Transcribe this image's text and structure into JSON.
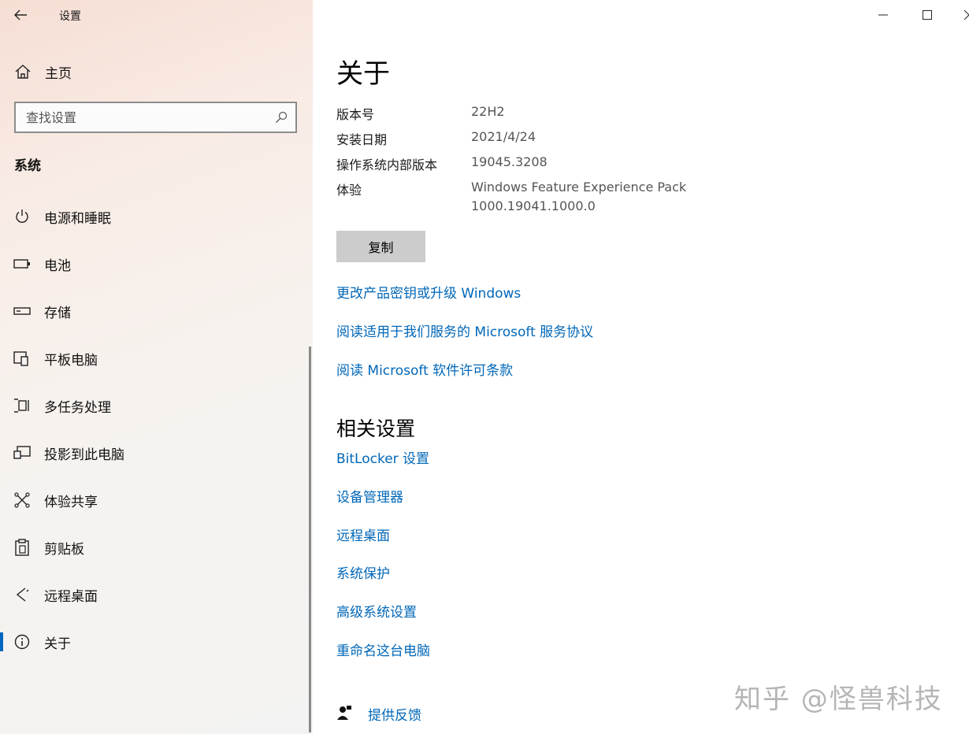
{
  "window": {
    "title": "设置",
    "controls": [
      "minimize-icon",
      "maximize-icon",
      "close-icon"
    ]
  },
  "sidebar": {
    "home_label": "主页",
    "search_placeholder": "查找设置",
    "section_label": "系统",
    "items": [
      {
        "label": "电源和睡眠",
        "icon": "power-icon"
      },
      {
        "label": "电池",
        "icon": "battery-icon"
      },
      {
        "label": "存储",
        "icon": "storage-icon"
      },
      {
        "label": "平板电脑",
        "icon": "tablet-icon"
      },
      {
        "label": "多任务处理",
        "icon": "multitasking-icon"
      },
      {
        "label": "投影到此电脑",
        "icon": "project-icon"
      },
      {
        "label": "体验共享",
        "icon": "shared-experiences-icon"
      },
      {
        "label": "剪贴板",
        "icon": "clipboard-icon"
      },
      {
        "label": "远程桌面",
        "icon": "remote-desktop-icon"
      },
      {
        "label": "关于",
        "icon": "info-icon",
        "active": true
      }
    ]
  },
  "main": {
    "title": "关于",
    "specs": [
      {
        "label": "版本号",
        "value": "22H2"
      },
      {
        "label": "安装日期",
        "value": "2021/4/24"
      },
      {
        "label": "操作系统内部版本",
        "value": "19045.3208"
      },
      {
        "label": "体验",
        "value": "Windows Feature Experience Pack",
        "value2": "1000.19041.1000.0"
      }
    ],
    "copy_label": "复制",
    "links": [
      "更改产品密钥或升级 Windows",
      "阅读适用于我们服务的 Microsoft 服务协议",
      "阅读 Microsoft 软件许可条款"
    ],
    "related_title": "相关设置",
    "related_links": [
      "BitLocker 设置",
      "设备管理器",
      "远程桌面",
      "系统保护",
      "高级系统设置",
      "重命名这台电脑"
    ],
    "feedback_label": "提供反馈"
  },
  "watermark": "知乎 @怪兽科技",
  "colors": {
    "accent": "#0067b8",
    "active_indicator": "#0067c0",
    "copy_button_bg": "#cccccc"
  }
}
